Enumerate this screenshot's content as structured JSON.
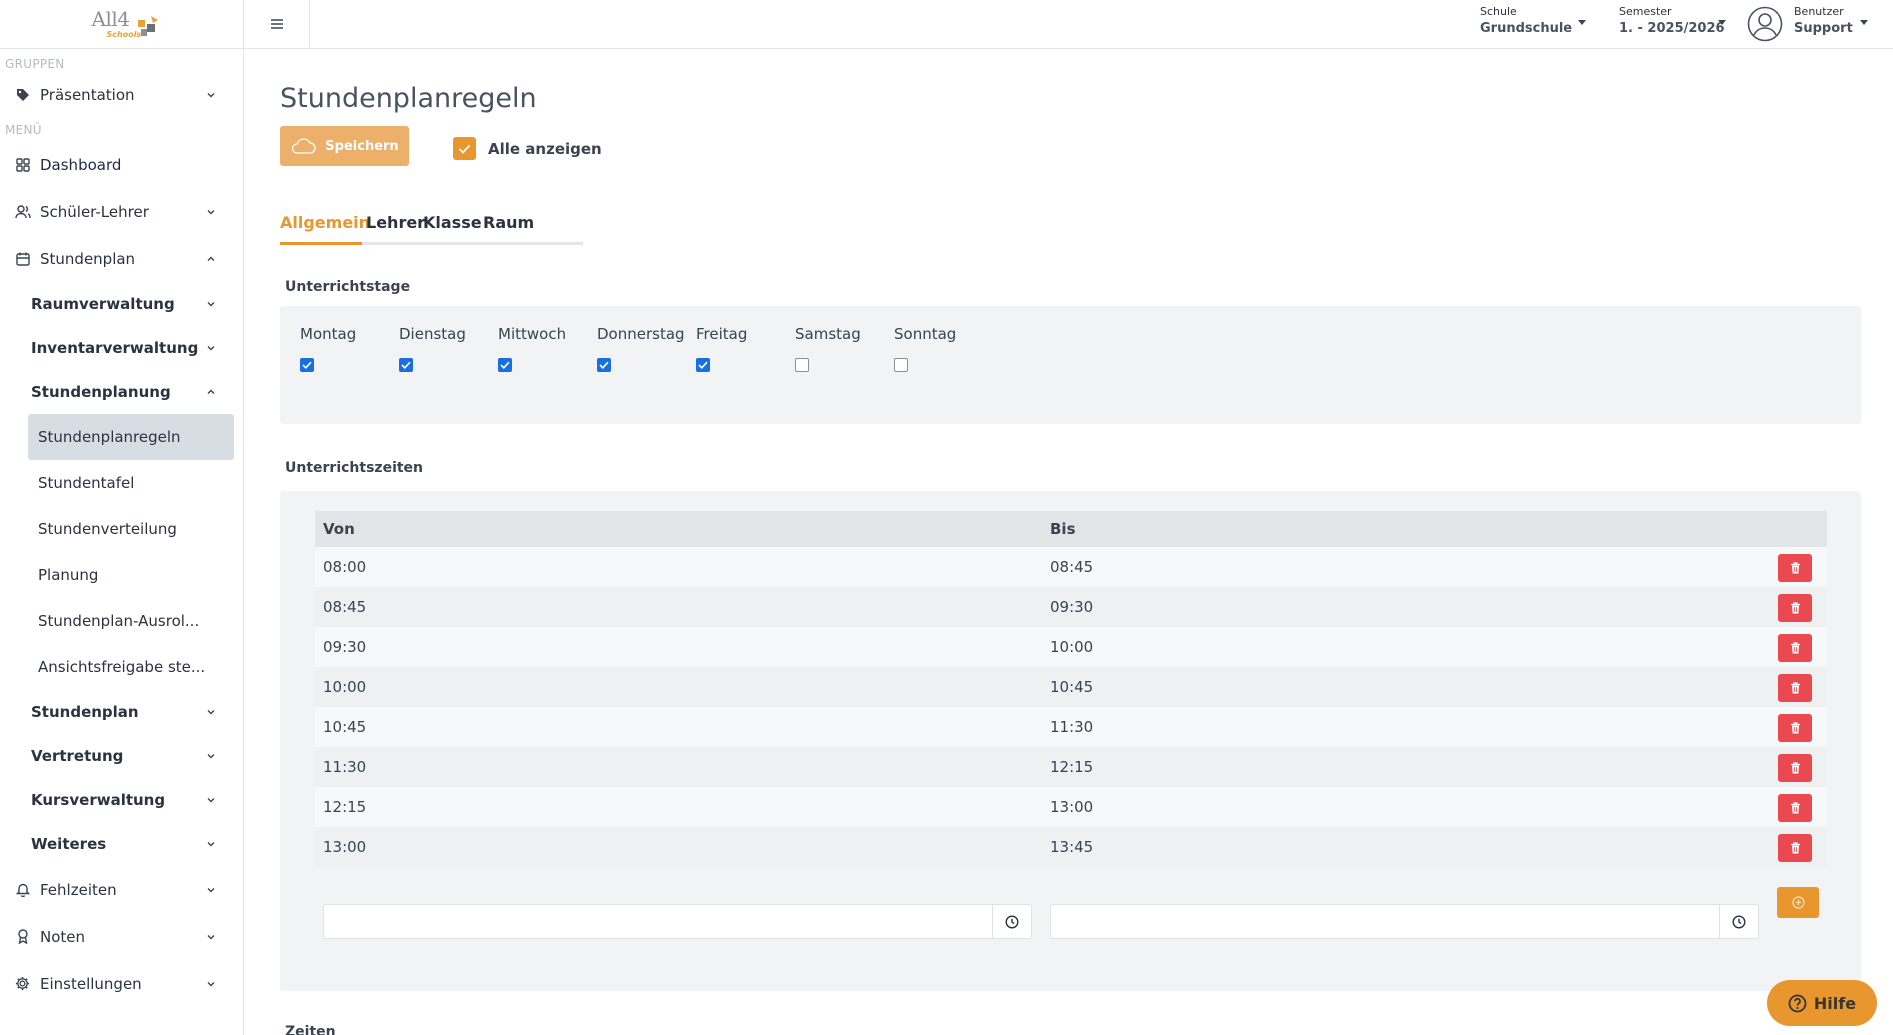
{
  "logo": {
    "main": "All4",
    "sub": "Schools"
  },
  "sidebar": {
    "groups_title": "GRUPPEN",
    "group_item": "Präsentation",
    "menu_title": "MENÜ",
    "items": [
      {
        "label": "Dashboard",
        "icon": "grid-icon"
      },
      {
        "label": "Schüler-Lehrer",
        "icon": "users-icon"
      },
      {
        "label": "Stundenplan",
        "icon": "calendar-icon"
      }
    ],
    "sub_items": [
      "Raumverwaltung",
      "Inventarverwaltung",
      "Stundenplanung"
    ],
    "leaves": [
      "Stundenplanregeln",
      "Stundentafel",
      "Stundenverteilung",
      "Planung",
      "Stundenplan-Ausrol...",
      "Ansichtsfreigabe ste..."
    ],
    "sub_items_after": [
      "Stundenplan",
      "Vertretung",
      "Kursverwaltung",
      "Weiteres"
    ],
    "bottom_items": [
      {
        "label": "Fehlzeiten",
        "icon": "bell-icon"
      },
      {
        "label": "Noten",
        "icon": "award-icon"
      },
      {
        "label": "Einstellungen",
        "icon": "gear-icon"
      }
    ]
  },
  "topbar": {
    "school_label": "Schule",
    "school_value": "Grundschule",
    "semester_label": "Semester",
    "semester_value": "1. - 2025/2026",
    "user_label": "Benutzer",
    "user_value": "Support"
  },
  "page": {
    "title": "Stundenplanregeln",
    "save_label": "Speichern",
    "show_all_label": "Alle anzeigen",
    "show_all_checked": true,
    "tabs": [
      "Allgemein",
      "Lehrer",
      "Klasse",
      "Raum"
    ],
    "active_tab": "Allgemein"
  },
  "teaching_days": {
    "title": "Unterrichtstage",
    "days": [
      {
        "label": "Montag",
        "checked": true
      },
      {
        "label": "Dienstag",
        "checked": true
      },
      {
        "label": "Mittwoch",
        "checked": true
      },
      {
        "label": "Donnerstag",
        "checked": true
      },
      {
        "label": "Freitag",
        "checked": true
      },
      {
        "label": "Samstag",
        "checked": false
      },
      {
        "label": "Sonntag",
        "checked": false
      }
    ]
  },
  "teaching_times": {
    "title": "Unterrichtszeiten",
    "col_from": "Von",
    "col_to": "Bis",
    "rows": [
      [
        "08:00",
        "08:45"
      ],
      [
        "08:45",
        "09:30"
      ],
      [
        "09:30",
        "10:00"
      ],
      [
        "10:00",
        "10:45"
      ],
      [
        "10:45",
        "11:30"
      ],
      [
        "11:30",
        "12:15"
      ],
      [
        "12:15",
        "13:00"
      ],
      [
        "13:00",
        "13:45"
      ]
    ],
    "new_from": "",
    "new_to": ""
  },
  "cut_section_title": "Zeiten",
  "help_label": "Hilfe",
  "colors": {
    "accent": "#e8972f",
    "danger": "#e9494f",
    "check": "#1a6fe0",
    "panel": "#f1f3f4"
  }
}
